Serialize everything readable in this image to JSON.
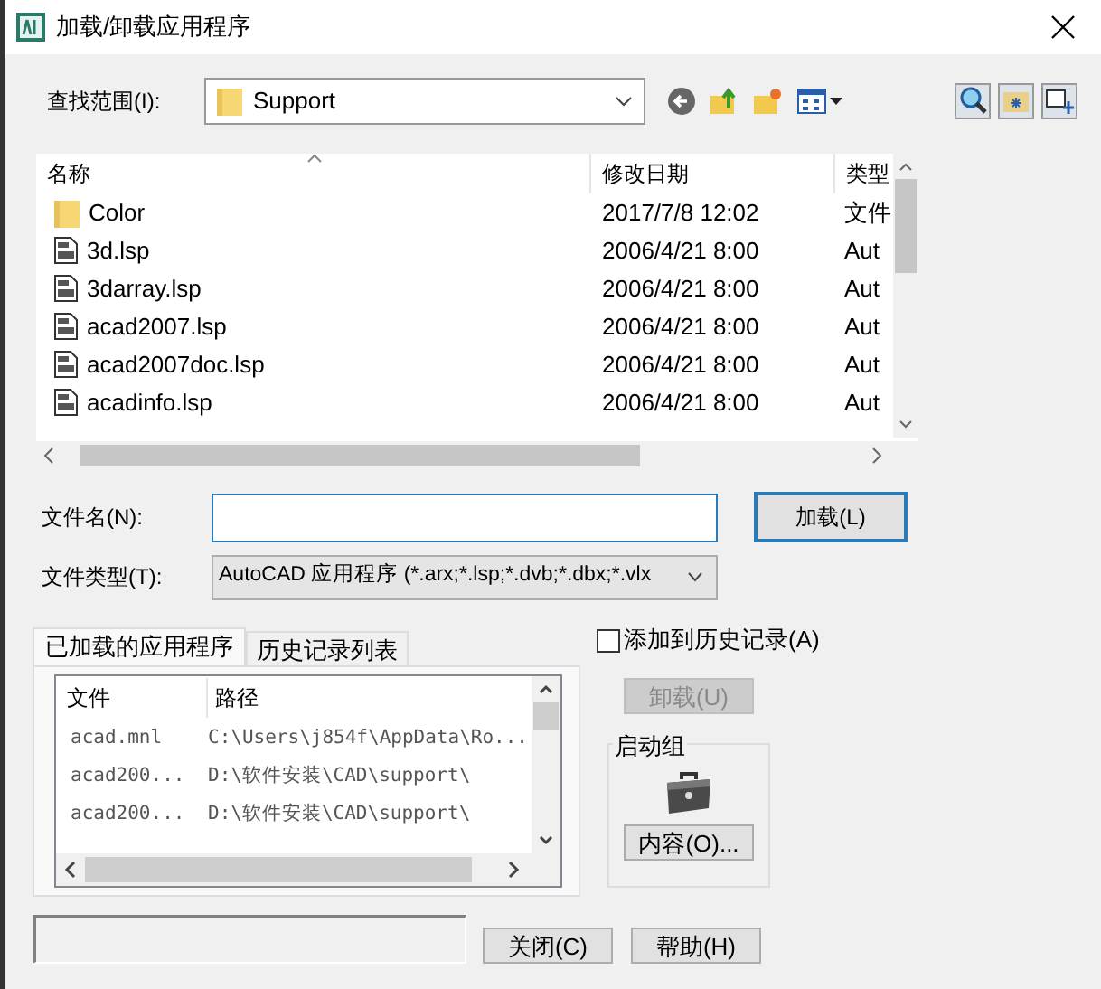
{
  "window": {
    "title": "加载/卸载应用程序"
  },
  "look_in": {
    "label": "查找范围(I):",
    "value": "Support"
  },
  "file_list": {
    "columns": [
      "名称",
      "修改日期",
      "类型"
    ],
    "rows": [
      {
        "kind": "folder",
        "name": "Color",
        "date": "2017/7/8 12:02",
        "type": "文件"
      },
      {
        "kind": "lsp",
        "name": "3d.lsp",
        "date": "2006/4/21 8:00",
        "type": "Aut"
      },
      {
        "kind": "lsp",
        "name": "3darray.lsp",
        "date": "2006/4/21 8:00",
        "type": "Aut"
      },
      {
        "kind": "lsp",
        "name": "acad2007.lsp",
        "date": "2006/4/21 8:00",
        "type": "Aut"
      },
      {
        "kind": "lsp",
        "name": "acad2007doc.lsp",
        "date": "2006/4/21 8:00",
        "type": "Aut"
      },
      {
        "kind": "lsp",
        "name": "acadinfo.lsp",
        "date": "2006/4/21 8:00",
        "type": "Aut"
      }
    ]
  },
  "file_name": {
    "label": "文件名(N):"
  },
  "load_button": "加载(L)",
  "file_type": {
    "label": "文件类型(T):",
    "value": "AutoCAD 应用程序 (*.arx;*.lsp;*.dvb;*.dbx;*.vlx"
  },
  "tabs": [
    {
      "label": "已加载的应用程序",
      "selected": true
    },
    {
      "label": "历史记录列表",
      "selected": false
    }
  ],
  "add_to_history": {
    "label": "添加到历史记录(A)",
    "checked": false
  },
  "loaded_apps": {
    "columns": [
      "文件",
      "路径"
    ],
    "rows": [
      {
        "file": "acad.mnl",
        "path": "C:\\Users\\j854f\\AppData\\Ro..."
      },
      {
        "file": "acad200...",
        "path": "D:\\软件安装\\CAD\\support\\"
      },
      {
        "file": "acad200...",
        "path": "D:\\软件安装\\CAD\\support\\"
      }
    ]
  },
  "unload_button": {
    "label": "卸载(U)",
    "disabled": true
  },
  "startup_suite": {
    "title": "启动组",
    "button": "内容(O)..."
  },
  "buttons": [
    "关闭(C)",
    "帮助(H)"
  ]
}
